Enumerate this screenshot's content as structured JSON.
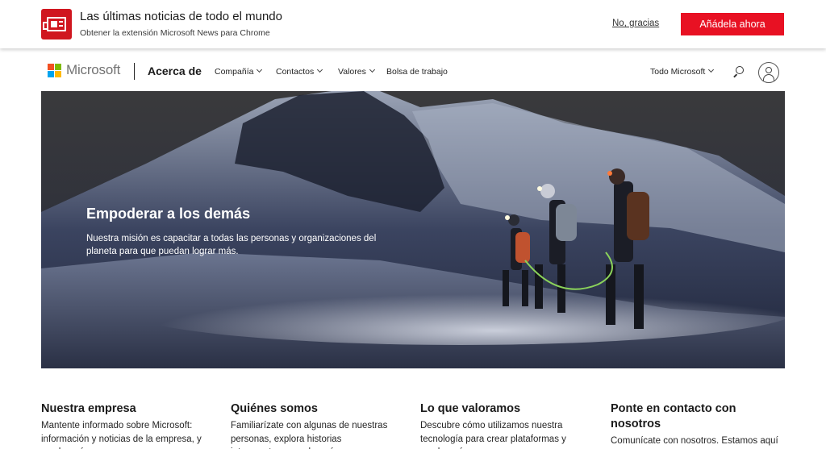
{
  "promo": {
    "icon": "news-icon",
    "title": "Las últimas noticias de todo el mundo",
    "subtitle": "Obtener la extensión Microsoft News para Chrome",
    "dismiss_label": "No, gracias",
    "add_label": "Añádela ahora",
    "accent_color": "#e81123"
  },
  "nav": {
    "brand": "Microsoft",
    "section": "Acerca de",
    "items": [
      {
        "label": "Compañía",
        "has_dropdown": true
      },
      {
        "label": "Contactos",
        "has_dropdown": true
      },
      {
        "label": "Valores",
        "has_dropdown": true
      },
      {
        "label": "Bolsa de trabajo",
        "has_dropdown": false
      }
    ],
    "all_microsoft": "Todo Microsoft",
    "search_icon": "search-icon",
    "account_icon": "account-icon"
  },
  "hero": {
    "title": "Empoderar a los demás",
    "text": "Nuestra misión es capacitar a todas las personas y organizaciones del planeta para que puedan lograr más."
  },
  "columns": [
    {
      "title": "Nuestra empresa",
      "text": "Mantente informado sobre Microsoft: información y noticias de la empresa, y mucho más"
    },
    {
      "title": "Quiénes somos",
      "text": "Familiarízate con algunas de nuestras personas, explora historias interesantes y mucho más"
    },
    {
      "title": "Lo que valoramos",
      "text": "Descubre cómo utilizamos nuestra tecnología para crear plataformas y mucho más"
    },
    {
      "title": "Ponte en contacto con nosotros",
      "text": "Comunícate con nosotros. Estamos aquí para ayudarte"
    }
  ]
}
